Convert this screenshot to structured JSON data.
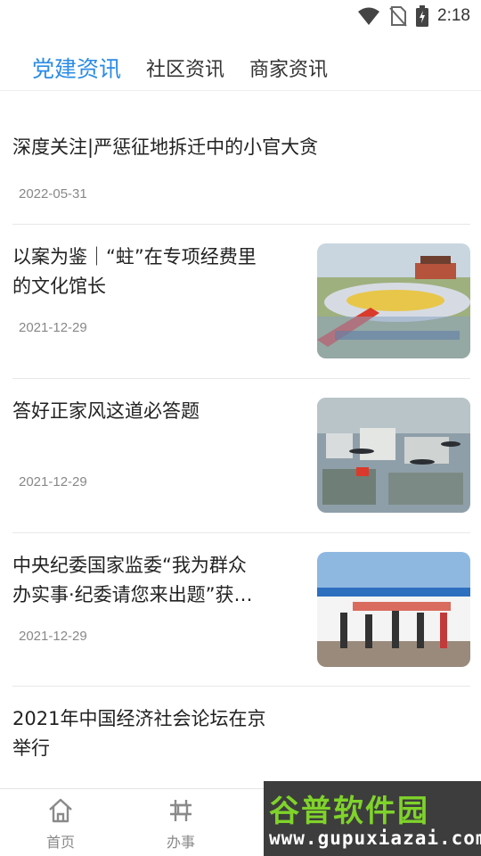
{
  "status": {
    "time": "2:18"
  },
  "tabs": [
    {
      "label": "党建资讯",
      "active": true
    },
    {
      "label": "社区资讯",
      "active": false
    },
    {
      "label": "商家资讯",
      "active": false
    }
  ],
  "articles": [
    {
      "title": "深度关注|严惩征地拆迁中的小官大贪",
      "date": "2022-05-31"
    },
    {
      "title_line1": "以案为鉴｜“蛀”在专项经费里",
      "title_line2": "的文化馆长",
      "date": "2021-12-29",
      "image": "tiananmen-square-ceremony"
    },
    {
      "title": "答好正家风这道必答题",
      "date": "2021-12-29",
      "image": "helicopters-over-city"
    },
    {
      "title_line1": "中央纪委国家监委“我为群众",
      "title_line2": "办实事·纪委请您来出题”获…",
      "date": "2021-12-29",
      "image": "event-banner-group-photo"
    },
    {
      "title_line1": "2021年中国经济社会论坛在京",
      "title_line2": "举行"
    }
  ],
  "bottom_nav": [
    {
      "label": "首页",
      "icon": "home-icon"
    },
    {
      "label": "办事",
      "icon": "service-icon"
    }
  ],
  "watermark": {
    "title": "谷普软件园",
    "url": "www.gupuxiazai.com"
  },
  "colors": {
    "accent": "#2b8be6",
    "watermark_green": "#7fd32a"
  }
}
